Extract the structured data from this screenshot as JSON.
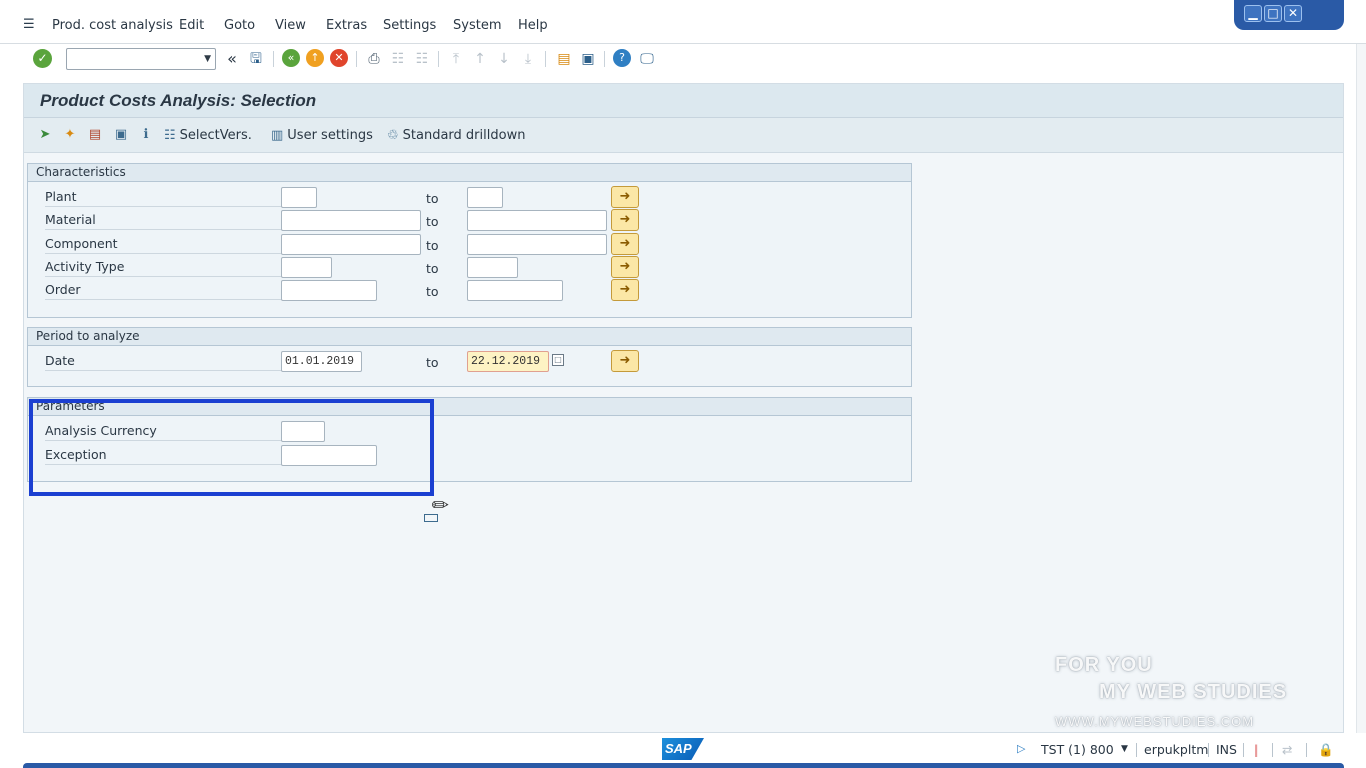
{
  "menubar": {
    "items": [
      {
        "label": "Prod. cost analysis"
      },
      {
        "label": "Edit"
      },
      {
        "label": "Goto"
      },
      {
        "label": "View"
      },
      {
        "label": "Extras"
      },
      {
        "label": "Settings"
      },
      {
        "label": "System"
      },
      {
        "label": "Help"
      }
    ]
  },
  "window_controls": {
    "minimize": "▁",
    "maximize": "□",
    "close": "✕"
  },
  "toolbar": {
    "command_field_value": "",
    "back_glyph": "«",
    "icons": [
      "enter-icon",
      "save-icon",
      "back-icon",
      "exit-icon",
      "cancel-icon",
      "print-icon",
      "find-icon",
      "find-next-icon",
      "first-page-icon",
      "previous-page-icon",
      "next-page-icon",
      "last-page-icon",
      "create-session-icon",
      "shortcut-icon",
      "help-icon",
      "customize-layout-icon"
    ]
  },
  "screen": {
    "title": "Product Costs Analysis: Selection",
    "app_toolbar": {
      "select_vers_label": "SelectVers.",
      "user_settings_label": "User settings",
      "standard_drilldown_label": "Standard drilldown"
    }
  },
  "characteristics": {
    "title": "Characteristics",
    "rows": [
      {
        "label": "Plant",
        "from": "",
        "to_label": "to",
        "to": ""
      },
      {
        "label": "Material",
        "from": "",
        "to_label": "to",
        "to": ""
      },
      {
        "label": "Component",
        "from": "",
        "to_label": "to",
        "to": ""
      },
      {
        "label": "Activity Type",
        "from": "",
        "to_label": "to",
        "to": ""
      },
      {
        "label": "Order",
        "from": "",
        "to_label": "to",
        "to": ""
      }
    ]
  },
  "period": {
    "title": "Period to analyze",
    "date_label": "Date",
    "date_from": "01.01.2019",
    "to_label": "to",
    "date_to": "22.12.2019"
  },
  "parameters": {
    "title": "Parameters",
    "analysis_currency_label": "Analysis Currency",
    "analysis_currency_value": "",
    "exception_label": "Exception",
    "exception_value": ""
  },
  "statusbar": {
    "sap_logo": "SAP",
    "system": "TST (1) 800",
    "user": "erpukpltm",
    "mode": "INS"
  },
  "watermark": {
    "line1": "FOR YOU",
    "line2": "MY WEB STUDIES",
    "line3": "WWW.MYWEBSTUDIES.COM"
  }
}
